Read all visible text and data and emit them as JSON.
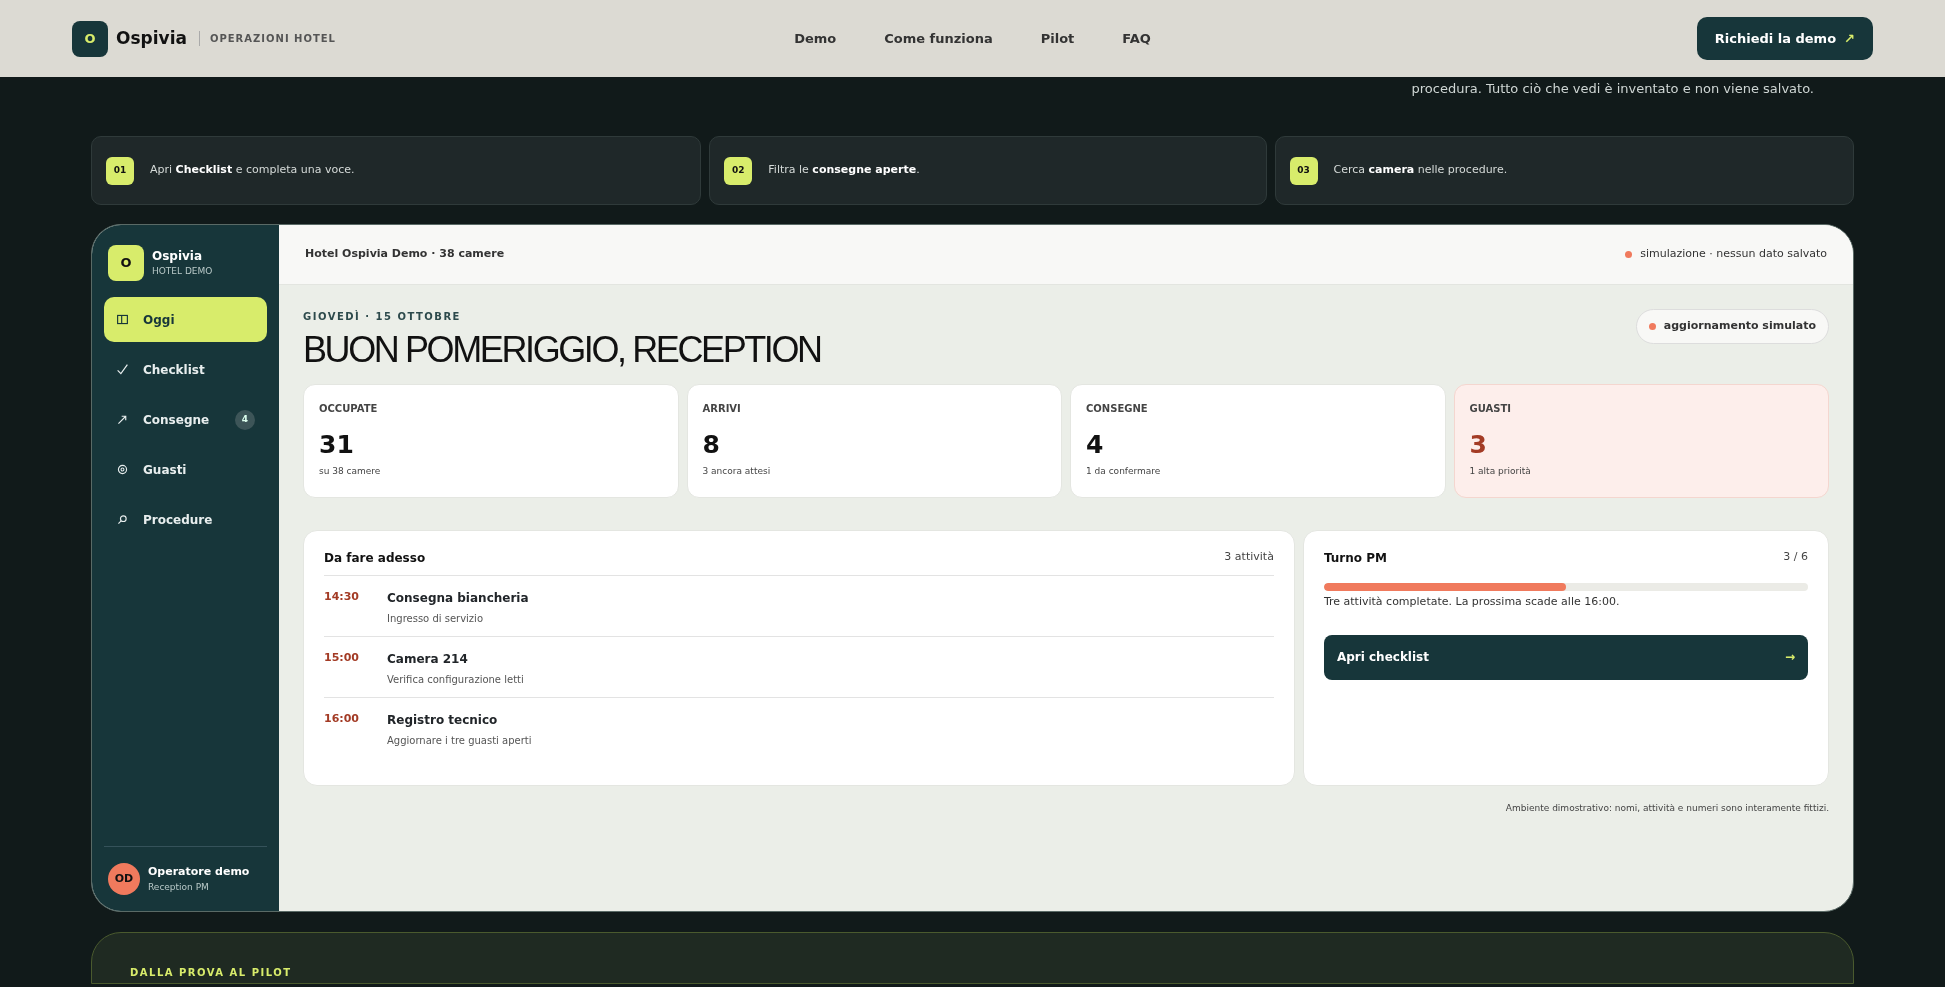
{
  "navbar": {
    "brand": "Ospivia",
    "logo_letter": "O",
    "tagline": "OPERAZIONI HOTEL",
    "links": [
      "Demo",
      "Come funziona",
      "Pilot",
      "FAQ"
    ],
    "cta": {
      "label": "Richiedi la demo",
      "icon": "↗"
    }
  },
  "hero": {
    "text": "procedura. Tutto ciò che vedi è inventato e non viene salvato."
  },
  "steps": [
    {
      "number": "01",
      "text": "Apri **Checklist** e completa una voce."
    },
    {
      "number": "02",
      "text": "Filtra le **consegne aperte**."
    },
    {
      "number": "03",
      "text": "Cerca **camera** nelle procedure."
    }
  ],
  "app": {
    "sidebar": {
      "brand": "Ospivia",
      "logo_letter": "O",
      "subtitle": "HOTEL DEMO",
      "items": [
        {
          "label": "Oggi",
          "selected": true
        },
        {
          "label": "Checklist",
          "selected": false
        },
        {
          "label": "Consegne",
          "selected": false,
          "badge": "4"
        },
        {
          "label": "Guasti",
          "selected": false
        },
        {
          "label": "Procedure",
          "selected": false
        }
      ],
      "user": {
        "initials": "OD",
        "name": "Operatore demo",
        "role": "Reception PM"
      }
    },
    "topbar": {
      "hotel": "Hotel Ospivia Demo · 38 camere",
      "status": "simulazione · nessun dato salvato"
    },
    "date": "GIOVEDÌ · 15 OTTOBRE",
    "greeting": "BUON POMERIGGIO, RECEPTION",
    "update_pill": "aggiornamento simulato",
    "stats": [
      {
        "label": "OCCUPATE",
        "value": "31",
        "note": "su 38 camere",
        "kind": "normal"
      },
      {
        "label": "ARRIVI",
        "value": "8",
        "note": "3 ancora attesi",
        "kind": "normal"
      },
      {
        "label": "CONSEGNE",
        "value": "4",
        "note": "1 da confermare",
        "kind": "normal"
      },
      {
        "label": "GUASTI",
        "value": "3",
        "note": "1 alta priorità",
        "kind": "alert"
      }
    ],
    "todo": {
      "title": "Da fare adesso",
      "count": "3 attività",
      "tasks": [
        {
          "time": "14:30",
          "title": "Consegna biancheria",
          "detail": "Ingresso di servizio"
        },
        {
          "time": "15:00",
          "title": "Camera 214",
          "detail": "Verifica configurazione letti"
        },
        {
          "time": "16:00",
          "title": "Registro tecnico",
          "detail": "Aggiornare i tre guasti aperti"
        }
      ]
    },
    "shift": {
      "title": "Turno PM",
      "count": "3 / 6",
      "level": 0.5,
      "note": "Tre attività completate. La prossima scade alle 16:00.",
      "button": {
        "label": "Apri checklist",
        "icon": "→"
      }
    },
    "footnote": "Ambiente dimostrativo: nomi, attività e numeri sono interamente fittizi."
  },
  "next_section": {
    "eyebrow": "DALLA PROVA AL PILOT"
  }
}
